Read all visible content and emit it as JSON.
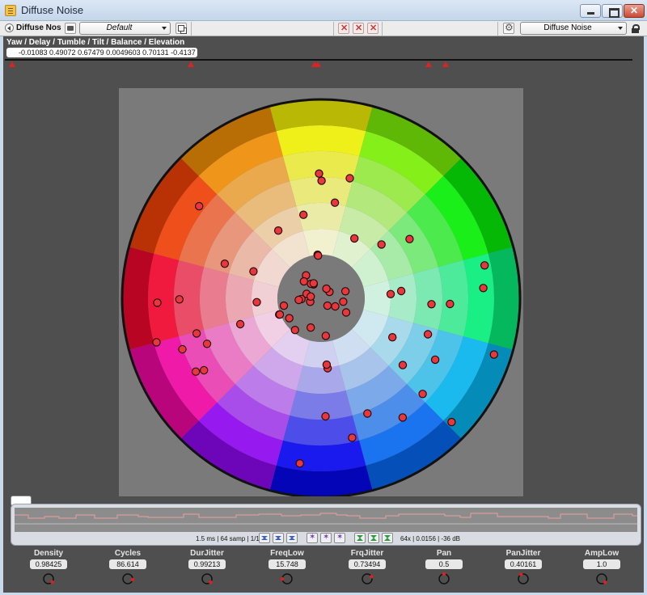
{
  "window": {
    "title": "Diffuse Noise"
  },
  "toolbar": {
    "plugin_short_name": "Diffuse Nos",
    "preset": "Default",
    "plugin_selector": "Diffuse Noise"
  },
  "params_panel": {
    "title": "Yaw / Delay / Tumble / Tilt / Balance / Elevation",
    "values": "-0.01083 0.49072 0.67479 0.0049603 0.70131 -0.4137"
  },
  "waveform": {
    "status": "1.5 ms | 64 samp | 1/16x",
    "rate_info": "64x | 0.0156 | -36 dB"
  },
  "knobs": [
    {
      "label": "Density",
      "value": "0.98425",
      "level": 0.98425
    },
    {
      "label": "Cycles",
      "value": "86.614",
      "level": 0.86614
    },
    {
      "label": "DurJitter",
      "value": "0.99213",
      "level": 0.99213
    },
    {
      "label": "FreqLow",
      "value": "15.748",
      "level": 0.16
    },
    {
      "label": "FrqJitter",
      "value": "0.73494",
      "level": 0.73494
    },
    {
      "label": "Pan",
      "value": "0.5",
      "level": 0.5
    },
    {
      "label": "PanJitter",
      "value": "0.40161",
      "level": 0.40161
    },
    {
      "label": "AmpLow",
      "value": "1.0",
      "level": 1.0
    }
  ],
  "colors": {
    "accent": "#e8383d",
    "panel_bg": "#4f4f4f",
    "marker": "#dd2222"
  }
}
